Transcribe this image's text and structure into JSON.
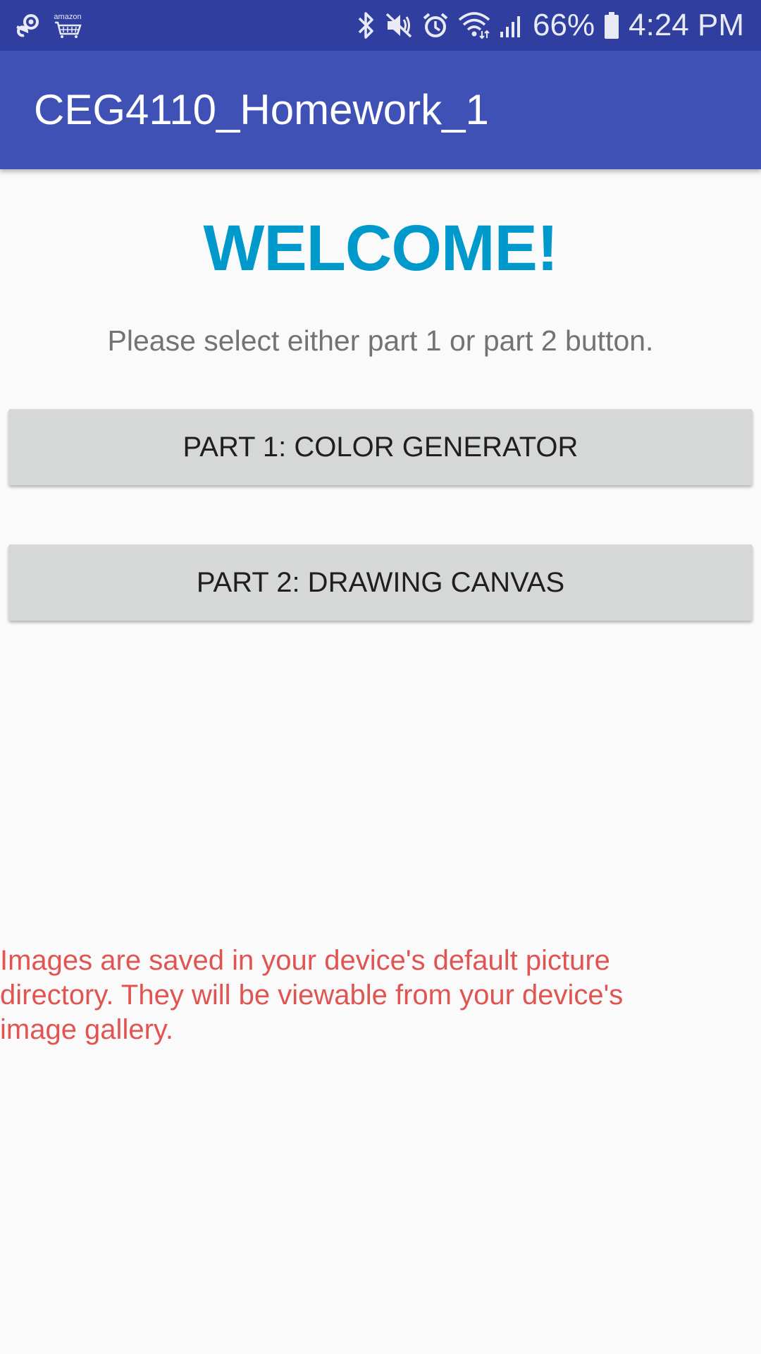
{
  "status_bar": {
    "left_icons": [
      "steam-icon",
      "amazon-icon"
    ],
    "amazon_word": "amazon",
    "right_icons": [
      "bluetooth-icon",
      "mute-icon",
      "alarm-icon",
      "wifi-icon",
      "signal-icon",
      "battery-icon"
    ],
    "battery": "66%",
    "time": "4:24 PM",
    "background_color": "#303f9f"
  },
  "app_bar": {
    "title": "CEG4110_Homework_1",
    "background_color": "#3f51b5"
  },
  "main": {
    "welcome": "WELCOME!",
    "welcome_color": "#0099cc",
    "instruction": "Please select either part 1 or part 2 button.",
    "buttons": [
      {
        "label": "PART 1: COLOR GENERATOR"
      },
      {
        "label": "PART 2: DRAWING CANVAS"
      }
    ],
    "note": "Images are saved in your device's default picture directory. They will be viewable from your device's image gallery.",
    "note_color": "#e05552"
  }
}
